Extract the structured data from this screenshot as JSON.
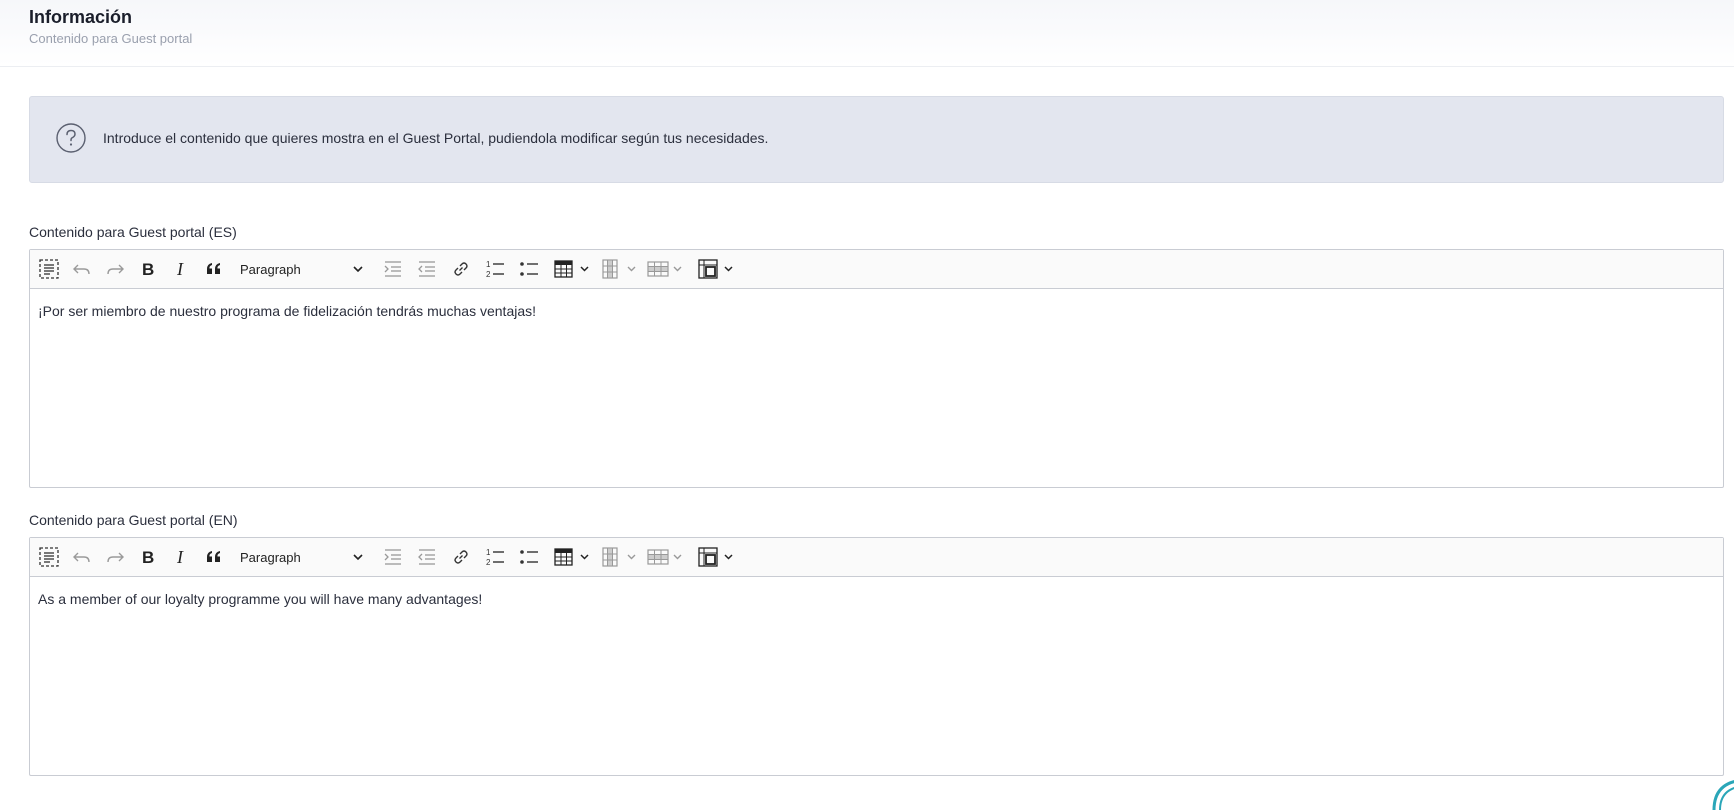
{
  "header": {
    "title": "Información",
    "subtitle": "Contenido para Guest portal"
  },
  "banner": {
    "icon": "help-circle-icon",
    "text": "Introduce el contenido que quieres mostra en el Guest Portal, pudiendola modificar según tus necesidades."
  },
  "editors": [
    {
      "label": "Contenido para Guest portal (ES)",
      "block_format": "Paragraph",
      "content": "¡Por ser miembro de nuestro programa de fidelización tendrás muchas ventajas!"
    },
    {
      "label": "Contenido para Guest portal (EN)",
      "block_format": "Paragraph",
      "content": "As a member of our loyalty programme you will have many advantages!"
    }
  ],
  "toolbar_icons": [
    "select-all-icon",
    "undo-icon",
    "redo-icon",
    "bold-icon",
    "italic-icon",
    "blockquote-icon",
    "indent-icon",
    "outdent-icon",
    "link-icon",
    "numbered-list-icon",
    "bulleted-list-icon",
    "table-icon",
    "table-column-icon",
    "table-row-icon",
    "merge-cells-icon"
  ],
  "colors": {
    "banner_bg": "#e3e6ef",
    "border": "#c9ccd3",
    "text": "#2b2f3d",
    "muted": "#9aa0ae",
    "accent": "#2aa6b8"
  }
}
